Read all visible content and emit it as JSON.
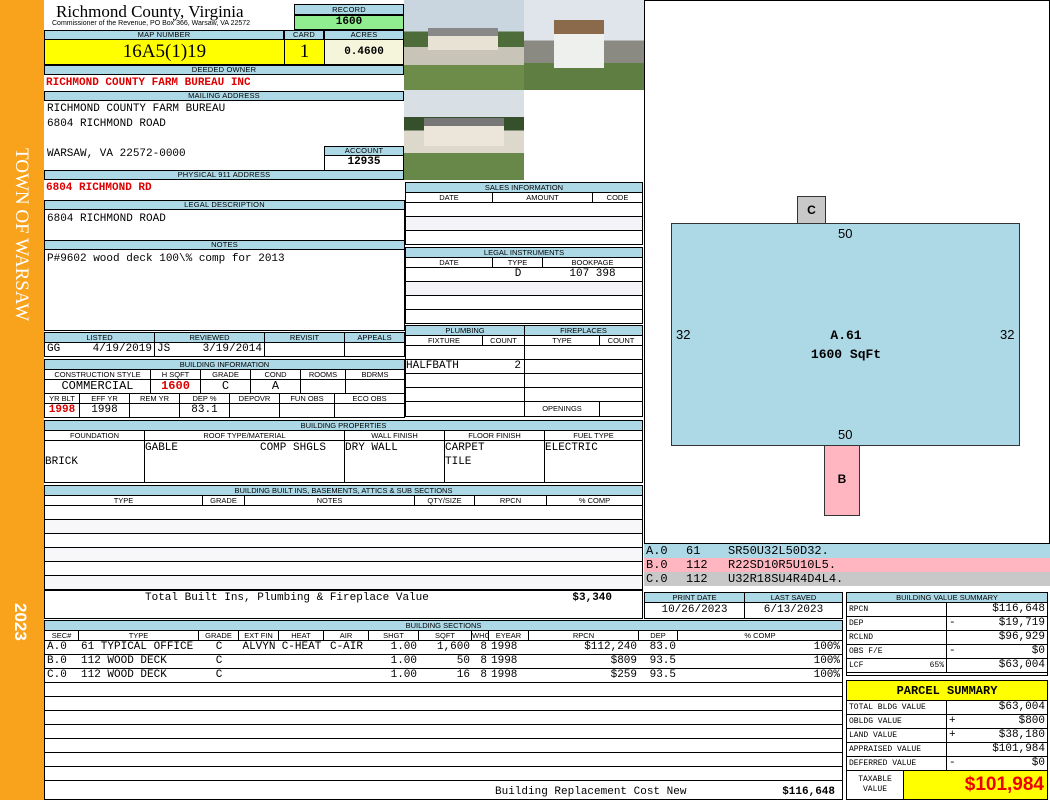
{
  "sidebar": {
    "town": "TOWN OF WARSAW",
    "year": "2023",
    "color": "#f9a21b"
  },
  "header": {
    "county": "Richmond County, Virginia",
    "office": "Commissioner of the Revenue, PO Box 366, Warsaw, VA 22572",
    "record_label": "RECORD",
    "record": "1600"
  },
  "parcel": {
    "map_label": "MAP NUMBER",
    "map_number": "16A5(1)19",
    "card_label": "CARD",
    "card": "1",
    "acres_label": "ACRES",
    "acres": "0.4600"
  },
  "owner": {
    "label": "DEEDED OWNER",
    "name": "RICHMOND COUNTY FARM BUREAU INC"
  },
  "mailing": {
    "label": "MAILING ADDRESS",
    "lines": [
      "RICHMOND COUNTY FARM BUREAU",
      "6804 RICHMOND ROAD",
      "",
      "WARSAW, VA 22572-0000"
    ],
    "account_label": "ACCOUNT",
    "account": "12935"
  },
  "physical": {
    "label": "PHYSICAL 911 ADDRESS",
    "value": "6804 RICHMOND RD"
  },
  "legal": {
    "label": "LEGAL DESCRIPTION",
    "value": "6804 RICHMOND ROAD"
  },
  "notes": {
    "label": "NOTES",
    "value": "P#9602 wood deck 100\\% comp for 2013"
  },
  "listing": {
    "headers": [
      "LISTED",
      "REVIEWED",
      "REVISIT",
      "APPEALS"
    ],
    "listed_by": "GG",
    "listed_date": "4/19/2019",
    "reviewed_by": "JS",
    "reviewed_date": "3/19/2014"
  },
  "building_info": {
    "label": "BUILDING INFORMATION",
    "h1": [
      "CONSTRUCTION STYLE",
      "H SQFT",
      "GRADE",
      "COND",
      "ROOMS",
      "BDRMS"
    ],
    "v1": [
      "COMMERCIAL",
      "1600",
      "C",
      "A",
      "",
      ""
    ],
    "h2": [
      "YR BLT",
      "EFF YR",
      "REM YR",
      "DEP %",
      "DEPOVR",
      "FUN OBS",
      "ECO OBS"
    ],
    "v2": [
      "1998",
      "1998",
      "",
      "83.1",
      "",
      "",
      ""
    ]
  },
  "sales": {
    "label": "SALES INFORMATION",
    "headers": [
      "DATE",
      "AMOUNT",
      "CODE"
    ]
  },
  "instruments": {
    "label": "LEGAL INSTRUMENTS",
    "headers": [
      "DATE",
      "TYPE",
      "BOOKPAGE"
    ],
    "rows": [
      [
        "",
        "D",
        "107 398"
      ]
    ]
  },
  "plumbing": {
    "label": "PLUMBING",
    "headers": [
      "FIXTURE",
      "COUNT"
    ],
    "rows": [
      [
        "",
        ""
      ],
      [
        "HALFBATH",
        "2"
      ]
    ]
  },
  "fireplaces": {
    "label": "FIREPLACES",
    "headers": [
      "TYPE",
      "COUNT"
    ],
    "openings": "OPENINGS"
  },
  "properties": {
    "label": "BUILDING PROPERTIES",
    "headers": [
      "FOUNDATION",
      "ROOF TYPE/MATERIAL",
      "WALL FINISH",
      "FLOOR FINISH",
      "FUEL TYPE"
    ],
    "foundation": "BRICK",
    "roof_type": "GABLE",
    "roof_material": "COMP SHGLS",
    "wall": "DRY WALL",
    "floor": [
      "CARPET",
      "TILE"
    ],
    "fuel": "ELECTRIC"
  },
  "builtins": {
    "label": "BUILDING BUILT INS, BASEMENTS, ATTICS & SUB SECTIONS",
    "headers": [
      "TYPE",
      "GRADE",
      "NOTES",
      "QTY/SIZE",
      "RPCN",
      "% COMP"
    ],
    "total_label": "Total Built Ins, Plumbing & Fireplace Value",
    "total": "$3,340"
  },
  "dates": {
    "print_label": "PRINT DATE",
    "print": "10/26/2023",
    "saved_label": "LAST SAVED",
    "saved": "6/13/2023"
  },
  "sections": {
    "label": "BUILDING SECTIONS",
    "headers": [
      "SEC#",
      "TYPE",
      "GRADE",
      "EXT FIN",
      "HEAT",
      "AIR",
      "SHGT",
      "SQFT",
      "WHGT",
      "EYEAR",
      "RPCN",
      "DEP",
      "% COMP"
    ],
    "rows": [
      [
        "A.0",
        "61 TYPICAL OFFICE",
        "C",
        "ALVYN",
        "C-HEAT",
        "C-AIR",
        "1.00",
        "1,600",
        "8",
        "1998",
        "$112,240",
        "83.0",
        "100%"
      ],
      [
        "B.0",
        "112 WOOD DECK",
        "C",
        "",
        "",
        "",
        "1.00",
        "50",
        "8",
        "1998",
        "$809",
        "93.5",
        "100%"
      ],
      [
        "C.0",
        "112 WOOD DECK",
        "C",
        "",
        "",
        "",
        "1.00",
        "16",
        "8",
        "1998",
        "$259",
        "93.5",
        "100%"
      ]
    ],
    "total_label": "Building Replacement Cost New",
    "total": "$116,648"
  },
  "sketch": {
    "a_label": "A.61",
    "a_area": "1600 SqFt",
    "top": "50",
    "bottom": "50",
    "left": "32",
    "right": "32",
    "b_label": "B",
    "c_label": "C",
    "codes": [
      {
        "sec": "A.0",
        "code": "61",
        "path": "SR50U32L50D32.",
        "color": "#add8e6"
      },
      {
        "sec": "B.0",
        "code": "112",
        "path": "R22SD10R5U10L5.",
        "color": "#ffb6c1"
      },
      {
        "sec": "C.0",
        "code": "112",
        "path": "U32R18SU4R4D4L4.",
        "color": "#c8c8c8"
      }
    ]
  },
  "value_summary": {
    "label": "BUILDING VALUE SUMMARY",
    "rows": [
      {
        "k": "RPCN",
        "op": "",
        "v": "$116,648"
      },
      {
        "k": "DEP",
        "op": "-",
        "v": "$19,719"
      },
      {
        "k": "RCLND",
        "op": "",
        "v": "$96,929"
      },
      {
        "k": "OBS F/E",
        "op": "-",
        "v": "$0"
      },
      {
        "k": "LCF",
        "pct": "65%",
        "op": "",
        "v": "$63,004"
      }
    ]
  },
  "parcel_summary": {
    "label": "PARCEL SUMMARY",
    "rows": [
      {
        "k": "TOTAL BLDG VALUE",
        "op": "",
        "v": "$63,004"
      },
      {
        "k": "OBLDG VALUE",
        "op": "+",
        "v": "$800"
      },
      {
        "k": "LAND VALUE",
        "op": "+",
        "v": "$38,180"
      },
      {
        "k": "APPRAISED VALUE",
        "op": "",
        "v": "$101,984"
      },
      {
        "k": "DEFERRED VALUE",
        "op": "-",
        "v": "$0"
      }
    ],
    "taxable_label": "TAXABLE VALUE",
    "taxable": "$101,984"
  }
}
